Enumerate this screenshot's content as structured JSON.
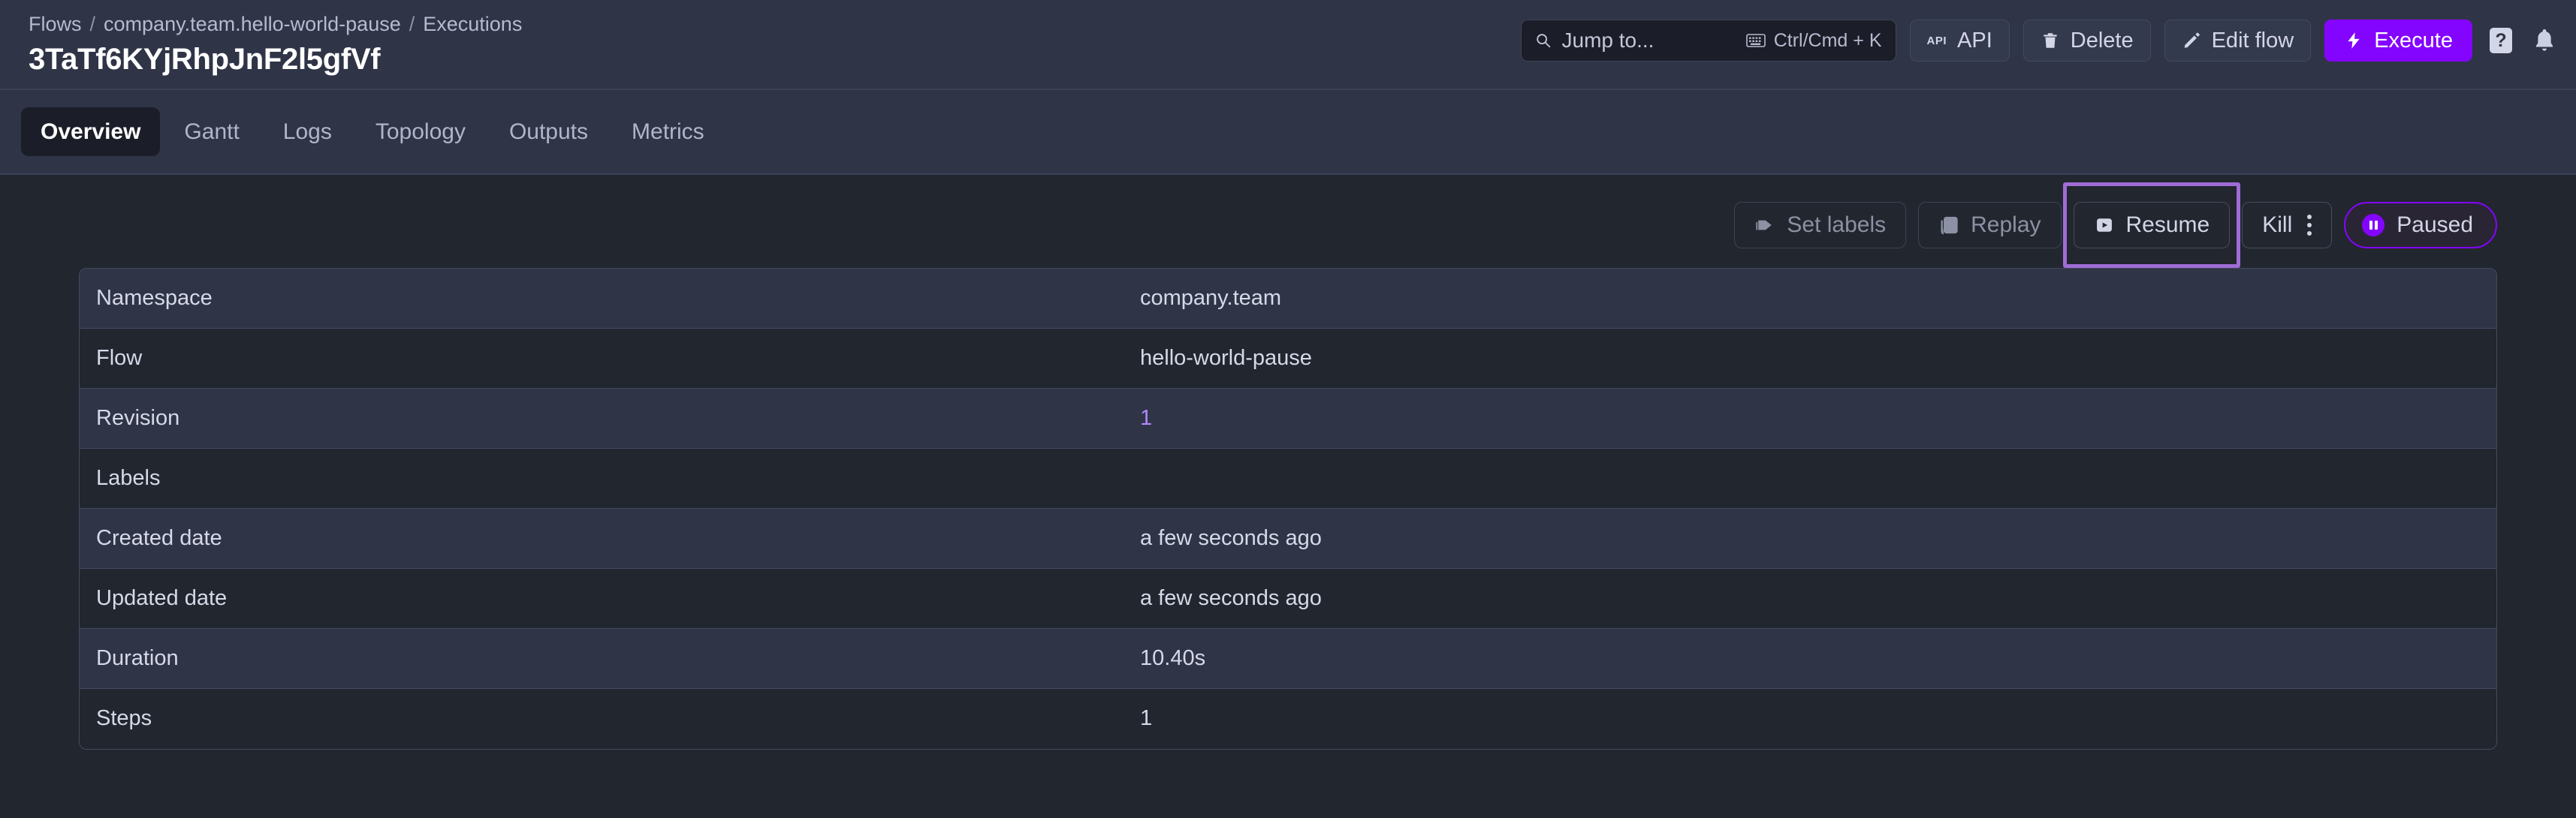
{
  "header": {
    "breadcrumb": [
      {
        "label": "Flows",
        "sep": "/"
      },
      {
        "label": "company.team.hello-world-pause",
        "sep": "/"
      },
      {
        "label": "Executions",
        "sep": ""
      }
    ],
    "breadcrumb_item_0": "Flows",
    "breadcrumb_sep_0": "/",
    "breadcrumb_item_1": "company.team.hello-world-pause",
    "breadcrumb_sep_1": "/",
    "breadcrumb_item_2": "Executions",
    "title": "3TaTf6KYjRhpJnF2l5gfVf",
    "search": {
      "placeholder": "Jump to...",
      "shortcut": "Ctrl/Cmd + K",
      "search_icon": "search-icon",
      "keyboard_icon": "keyboard-icon"
    },
    "buttons": {
      "api": "API",
      "api_glyph": "API",
      "delete": "Delete",
      "edit_flow": "Edit flow",
      "execute": "Execute"
    },
    "icons": {
      "help": "?",
      "bell": "bell-icon"
    }
  },
  "tabs": [
    {
      "label": "Overview",
      "active": true
    },
    {
      "label": "Gantt",
      "active": false
    },
    {
      "label": "Logs",
      "active": false
    },
    {
      "label": "Topology",
      "active": false
    },
    {
      "label": "Outputs",
      "active": false
    },
    {
      "label": "Metrics",
      "active": false
    }
  ],
  "tab_labels": {
    "overview": "Overview",
    "gantt": "Gantt",
    "logs": "Logs",
    "topology": "Topology",
    "outputs": "Outputs",
    "metrics": "Metrics"
  },
  "actions": {
    "set_labels": "Set labels",
    "replay": "Replay",
    "resume": "Resume",
    "kill": "Kill",
    "status": "Paused"
  },
  "table": {
    "rows": [
      {
        "label": "Namespace",
        "value": "company.team",
        "link": false
      },
      {
        "label": "Flow",
        "value": "hello-world-pause",
        "link": false
      },
      {
        "label": "Revision",
        "value": "1",
        "link": true
      },
      {
        "label": "Labels",
        "value": "",
        "link": false
      },
      {
        "label": "Created date",
        "value": "a few seconds ago",
        "link": false
      },
      {
        "label": "Updated date",
        "value": "a few seconds ago",
        "link": false
      },
      {
        "label": "Duration",
        "value": "10.40s",
        "link": false
      },
      {
        "label": "Steps",
        "value": "1",
        "link": false
      }
    ]
  },
  "colors": {
    "accent": "#8405ff",
    "link": "#b388ff",
    "highlight": "#a06cd5",
    "header_bg": "#2f3447",
    "content_bg": "#22262f",
    "row_odd": "#2f3447",
    "row_even": "#22262f",
    "border": "#444b60"
  }
}
